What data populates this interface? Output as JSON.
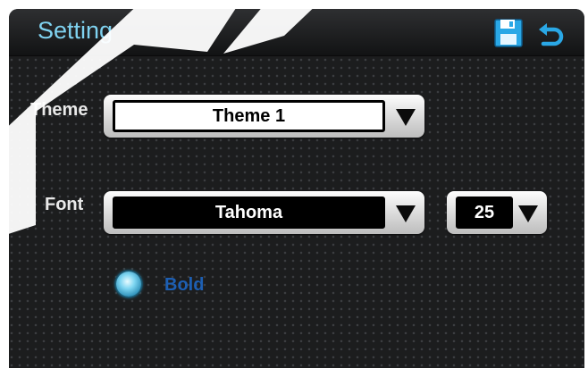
{
  "header": {
    "title": "Setting",
    "icons": [
      "save-icon",
      "back-icon"
    ]
  },
  "form": {
    "theme": {
      "label": "Theme",
      "value": "Theme 1"
    },
    "font": {
      "label": "Font",
      "value": "Tahoma",
      "size": "25"
    },
    "bold": {
      "label": "Bold",
      "selected": true
    }
  },
  "colors": {
    "accent": "#7fd2f0",
    "bold_label": "#1d5fb3",
    "background": "#1c1d1e"
  }
}
